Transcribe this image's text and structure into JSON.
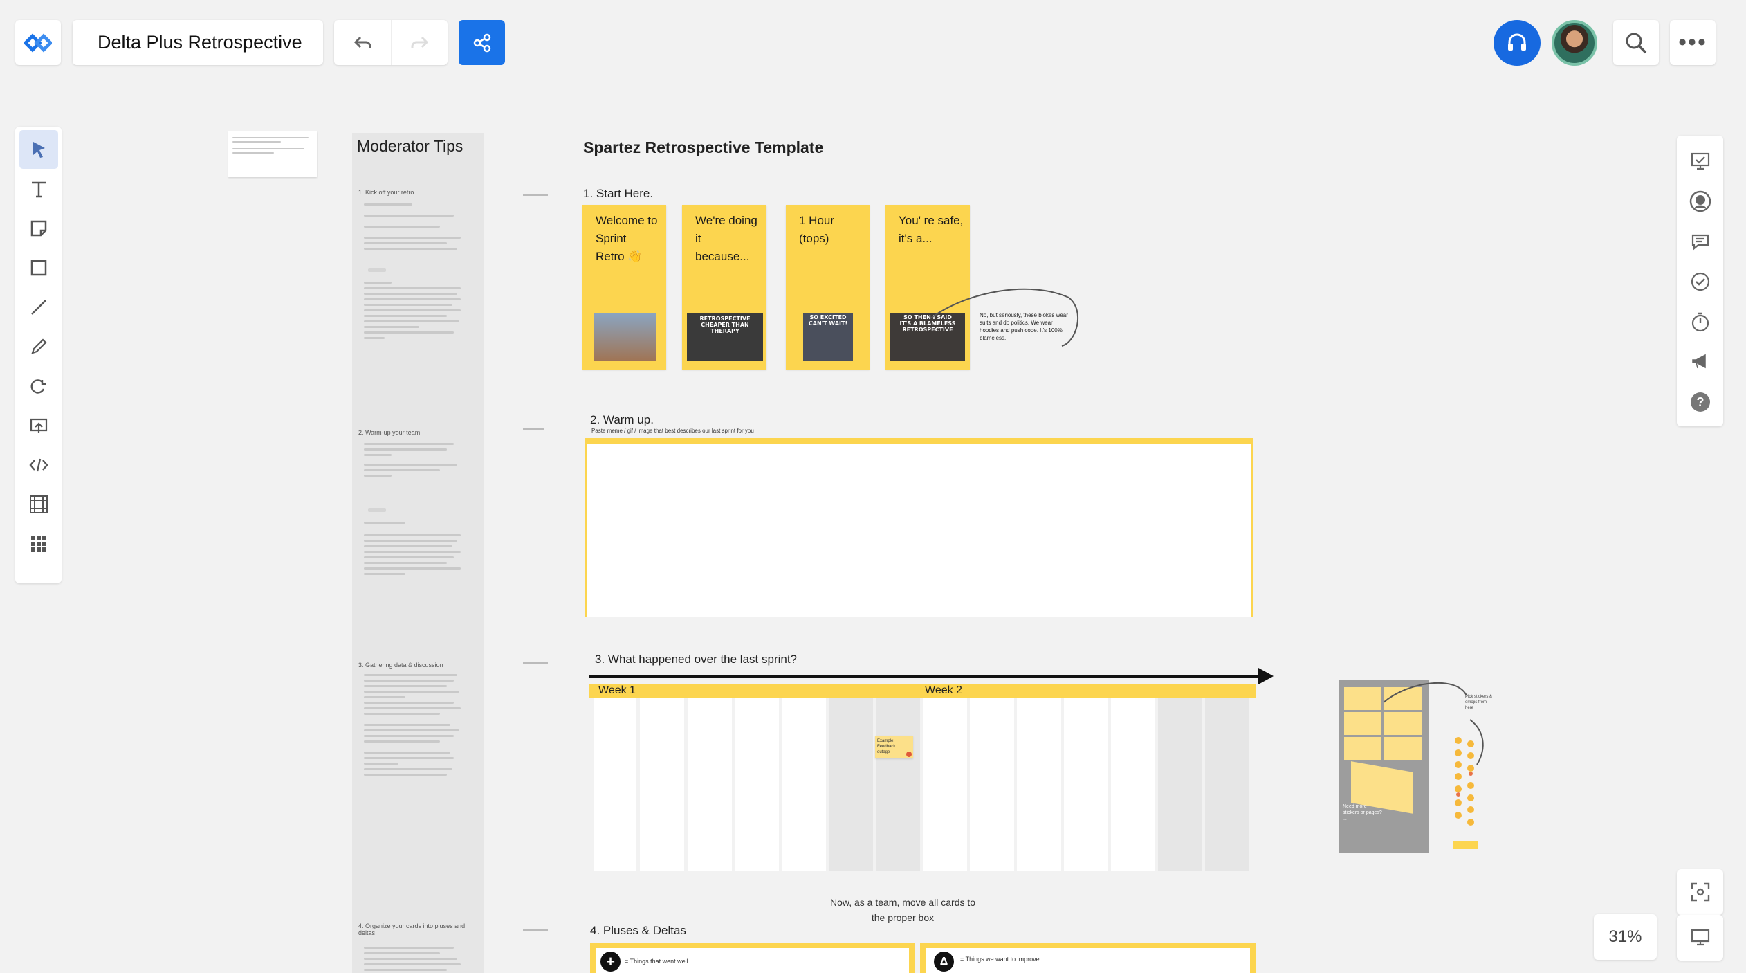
{
  "header": {
    "board_title": "Delta Plus Retrospective",
    "brand_color": "#1a73e8",
    "icons": [
      "logo-icon",
      "undo-icon",
      "redo-icon",
      "share-icon",
      "headset-icon",
      "search-icon",
      "more-icon"
    ],
    "more_label": "•••"
  },
  "left_toolbar": [
    "select-tool",
    "text-tool",
    "sticky-note-tool",
    "shape-tool",
    "line-tool",
    "pen-tool",
    "lasso-tool",
    "upload-tool",
    "embed-tool",
    "frame-tool",
    "apps-tool"
  ],
  "right_toolbar": [
    "presentation-icon",
    "avatar-icon",
    "comments-icon",
    "tasks-icon",
    "timer-icon",
    "announcement-icon",
    "help-icon"
  ],
  "zoom": "31%",
  "moderator": {
    "title": "Moderator Tips",
    "sections": [
      "1. Kick off your retro",
      "2. Warm-up your team.",
      "3. Gathering data & discussion",
      "4. Organize your cards into pluses and deltas"
    ]
  },
  "board": {
    "title": "Spartez Retrospective Template",
    "section1": "1. Start Here.",
    "stickies": [
      {
        "text": "Welcome to Sprint Retro 👋",
        "meme": ""
      },
      {
        "text": "We're doing it because...",
        "meme": "RETROSPECTIVE\nCHEAPER THAN THERAPY"
      },
      {
        "text": "1 Hour (tops)",
        "meme": "SO EXCITED\nCAN'T WAIT!"
      },
      {
        "text": "You' re safe, it's a...",
        "meme": "SO THEN I SAID\nIT'S A BLAMELESS RETROSPECTIVE"
      }
    ],
    "annotation": "No, but seriously, these blokes wear suits and do politics. We wear hoodies and push code. It's 100% blameless.",
    "section2": "2. Warm up.",
    "section2_sub": "Paste meme / gif / image that best describes our last sprint for you",
    "section3": "3. What happened over the last sprint?",
    "week1": "Week 1",
    "week2": "Week 2",
    "example_card": "Example: Feedback outage",
    "move_note": "Now, as a team, move all cards to the proper box",
    "section4": "4. Pluses & Deltas",
    "plus_label": "= Things that went well",
    "delta_label": "= Things we want to improve",
    "plus_symbol": "+",
    "delta_symbol": "Δ",
    "legend_note": "Need more stickers or pages? ...",
    "emoji_note": "Pick stickers & emojis from here"
  }
}
